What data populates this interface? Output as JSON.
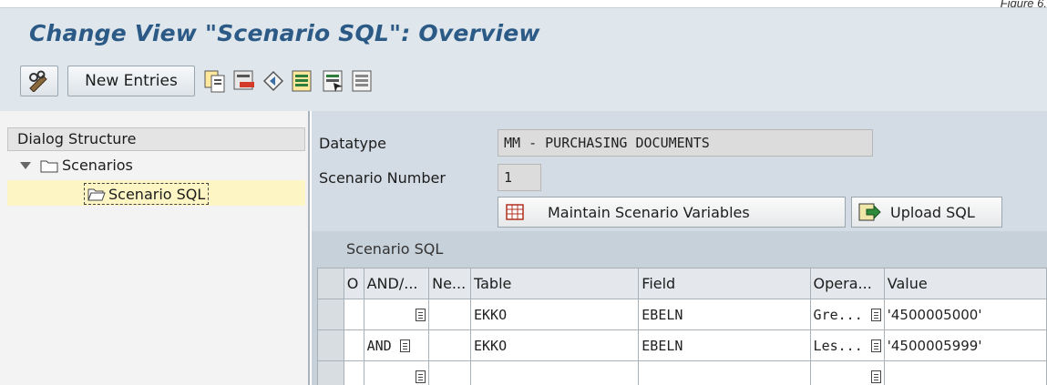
{
  "figure_tag": "Figure 6.",
  "title": "Change View \"Scenario SQL\": Overview",
  "toolbar": {
    "new_entries_label": "New Entries"
  },
  "dialog_structure": {
    "heading": "Dialog Structure",
    "tree": [
      {
        "label": "Scenarios",
        "level": 0,
        "expanded": true
      },
      {
        "label": "Scenario SQL",
        "level": 1,
        "selected": true
      }
    ]
  },
  "form": {
    "datatype_label": "Datatype",
    "datatype_value": "MM - PURCHASING DOCUMENTS",
    "scenario_number_label": "Scenario Number",
    "scenario_number_value": "1"
  },
  "buttons": {
    "maintain_label": "Maintain Scenario Variables",
    "upload_label": "Upload SQL"
  },
  "table": {
    "title": "Scenario SQL",
    "columns": [
      "O",
      "AND/...",
      "Ne...",
      "Table",
      "Field",
      "Opera...",
      "Value"
    ],
    "rows": [
      {
        "and_or": "",
        "table": "EKKO",
        "field": "EBELN",
        "operator": "Gre...",
        "value": "'4500005000'"
      },
      {
        "and_or": "AND",
        "table": "EKKO",
        "field": "EBELN",
        "operator": "Les...",
        "value": "'4500005999'"
      },
      {
        "and_or": "",
        "table": "",
        "field": "",
        "operator": "",
        "value": ""
      }
    ]
  },
  "colors": {
    "title": "#2c5a86",
    "toolbar_bg": "#dfe6ec",
    "panel_bg": "#d3dce4",
    "selection": "#fdf6c4"
  }
}
